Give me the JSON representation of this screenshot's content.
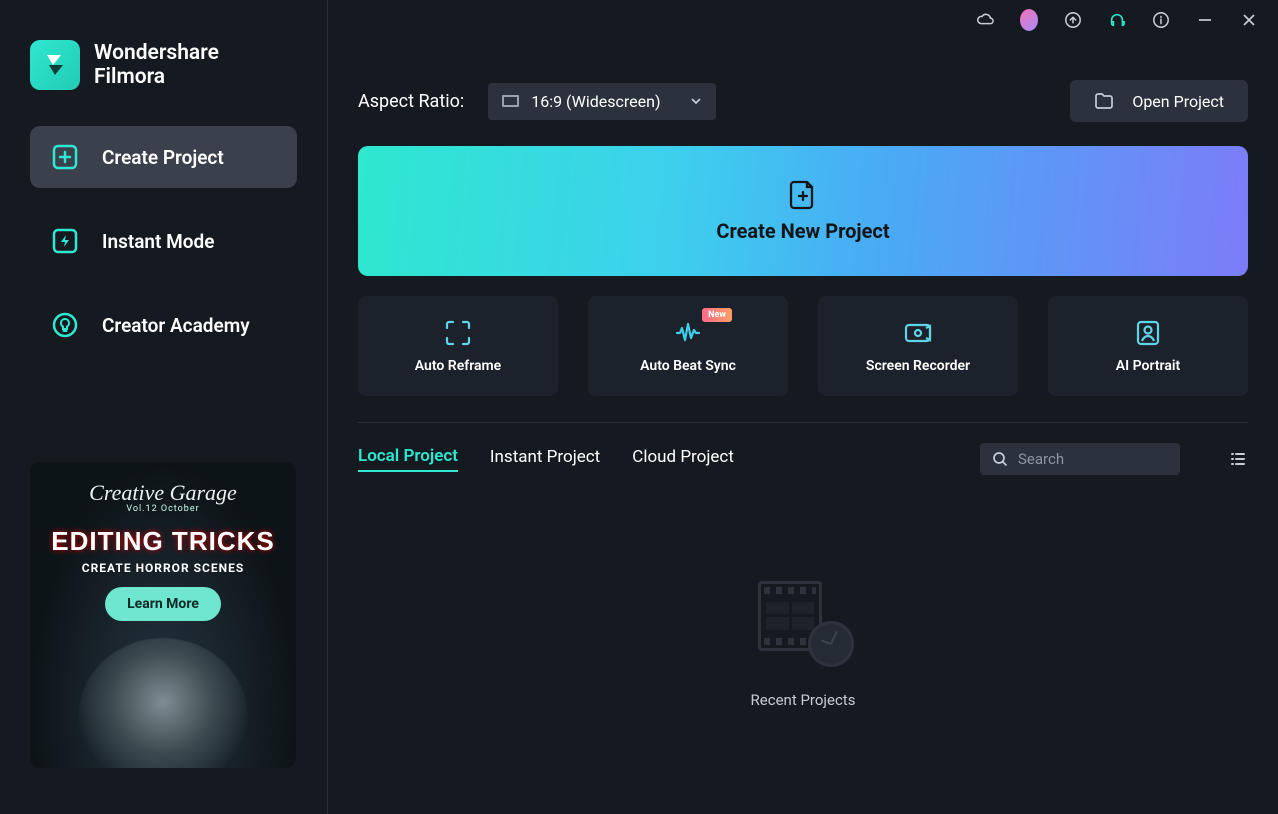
{
  "app": {
    "name_line1": "Wondershare",
    "name_line2": "Filmora"
  },
  "sidebar": {
    "items": [
      {
        "label": "Create Project"
      },
      {
        "label": "Instant Mode"
      },
      {
        "label": "Creator Academy"
      }
    ]
  },
  "promo": {
    "script": "Creative Garage",
    "sub": "Vol.12 October",
    "title": "EDITING TRICKS",
    "tagline": "CREATE HORROR SCENES",
    "cta": "Learn More"
  },
  "toolbar": {
    "aspect_label": "Aspect Ratio:",
    "aspect_value": "16:9 (Widescreen)",
    "open_project": "Open Project"
  },
  "hero": {
    "title": "Create New Project"
  },
  "features": [
    {
      "label": "Auto Reframe"
    },
    {
      "label": "Auto Beat Sync",
      "new": "New"
    },
    {
      "label": "Screen Recorder"
    },
    {
      "label": "AI Portrait"
    }
  ],
  "tabs": [
    {
      "label": "Local Project"
    },
    {
      "label": "Instant Project"
    },
    {
      "label": "Cloud Project"
    }
  ],
  "search": {
    "placeholder": "Search"
  },
  "empty": {
    "label": "Recent Projects"
  },
  "colors": {
    "accent": "#2ee8cf"
  }
}
